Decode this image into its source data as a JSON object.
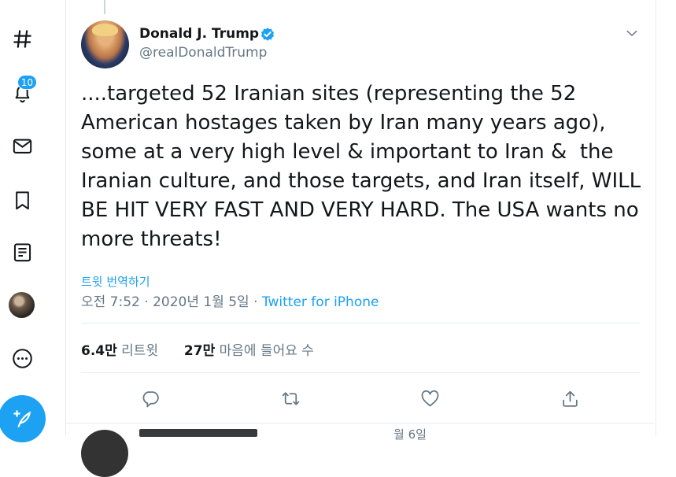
{
  "nav": {
    "notifications_badge": "10",
    "items": [
      "explore-icon",
      "notifications-icon",
      "messages-icon",
      "bookmarks-icon",
      "lists-icon",
      "profile-avatar",
      "more-icon"
    ],
    "compose": "compose-tweet-icon"
  },
  "tweet": {
    "author_name": "Donald J. Trump",
    "author_handle": "@realDonaldTrump",
    "verified": true,
    "text": "....targeted 52 Iranian sites (representing the 52 American hostages taken by Iran many years ago), some at a very high level & important to Iran &  the Iranian culture, and those targets, and Iran itself, WILL BE HIT VERY FAST AND VERY HARD. The USA wants no more threats!",
    "translate_label": "트윗 번역하기",
    "time": "오전 7:52",
    "date": "2020년 1월 5일",
    "separator": "·",
    "source": "Twitter for iPhone",
    "retweets_count": "6.4만",
    "retweets_label": "리트윗",
    "likes_count": "27만",
    "likes_label": "마음에 들어요 수",
    "actions": [
      "reply-icon",
      "retweet-icon",
      "like-icon",
      "share-icon"
    ]
  },
  "next_tweet": {
    "date_partial": "월 6일"
  },
  "colors": {
    "accent": "#1da1f2",
    "text": "#14171a",
    "secondary": "#657786",
    "border": "#e6ecf0"
  }
}
